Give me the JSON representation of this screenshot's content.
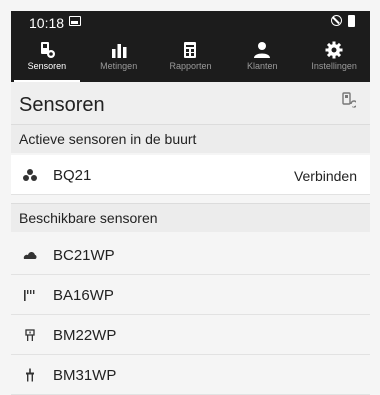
{
  "status_bar": {
    "time": "10:18"
  },
  "tabs": [
    {
      "label": "Sensoren",
      "active": true
    },
    {
      "label": "Metingen",
      "active": false
    },
    {
      "label": "Rapporten",
      "active": false
    },
    {
      "label": "Klanten",
      "active": false
    },
    {
      "label": "Instellingen",
      "active": false
    }
  ],
  "header": {
    "title": "Sensoren"
  },
  "active_section": {
    "label": "Actieve sensoren in de buurt",
    "items": [
      {
        "name": "BQ21",
        "action": "Verbinden"
      }
    ]
  },
  "available_section": {
    "label": "Beschikbare sensoren",
    "items": [
      {
        "name": "BC21WP",
        "icon": "cloud-sensor-icon"
      },
      {
        "name": "BA16WP",
        "icon": "antenna-sensor-icon"
      },
      {
        "name": "BM22WP",
        "icon": "moisture-sensor-icon"
      },
      {
        "name": "BM31WP",
        "icon": "probe-sensor-icon"
      }
    ]
  },
  "colors": {
    "topbar": "#1c1c1c",
    "background": "#f5f5f5",
    "section": "#ececec"
  }
}
